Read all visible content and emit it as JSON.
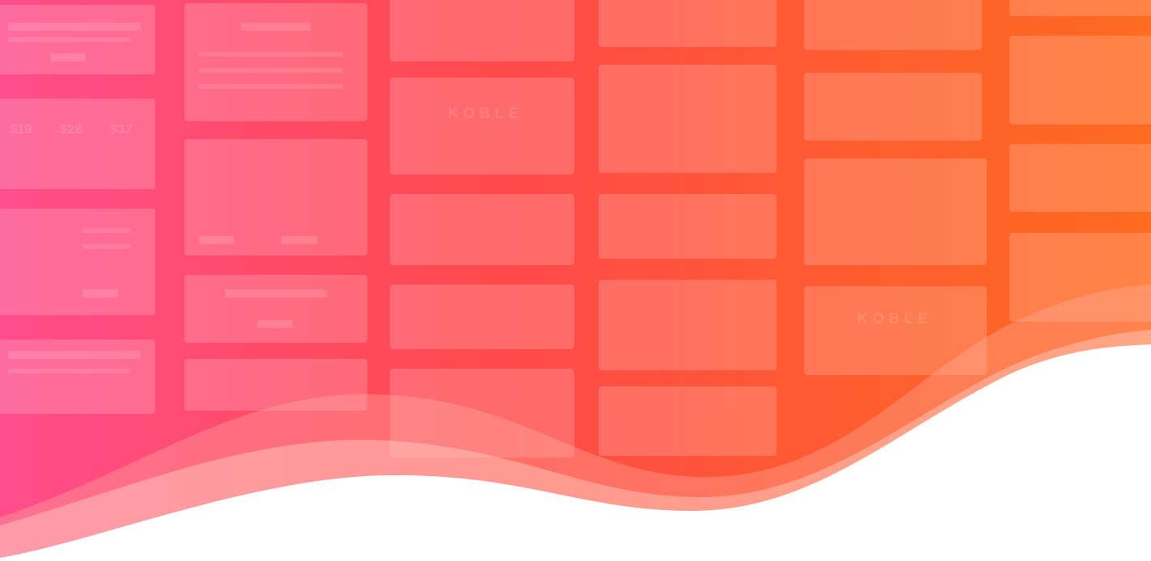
{
  "background": {
    "gradient_start": "#ff4d8d",
    "gradient_mid": "#ff4a4a",
    "gradient_end": "#ff6a1f",
    "wave_fill": "#ffffff",
    "wave_tint": "#ffb3a3"
  },
  "decorative_text": {
    "prices": [
      "$19",
      "$28",
      "$37"
    ],
    "brand_1": "KOBLE",
    "brand_2": "KOBLE"
  }
}
